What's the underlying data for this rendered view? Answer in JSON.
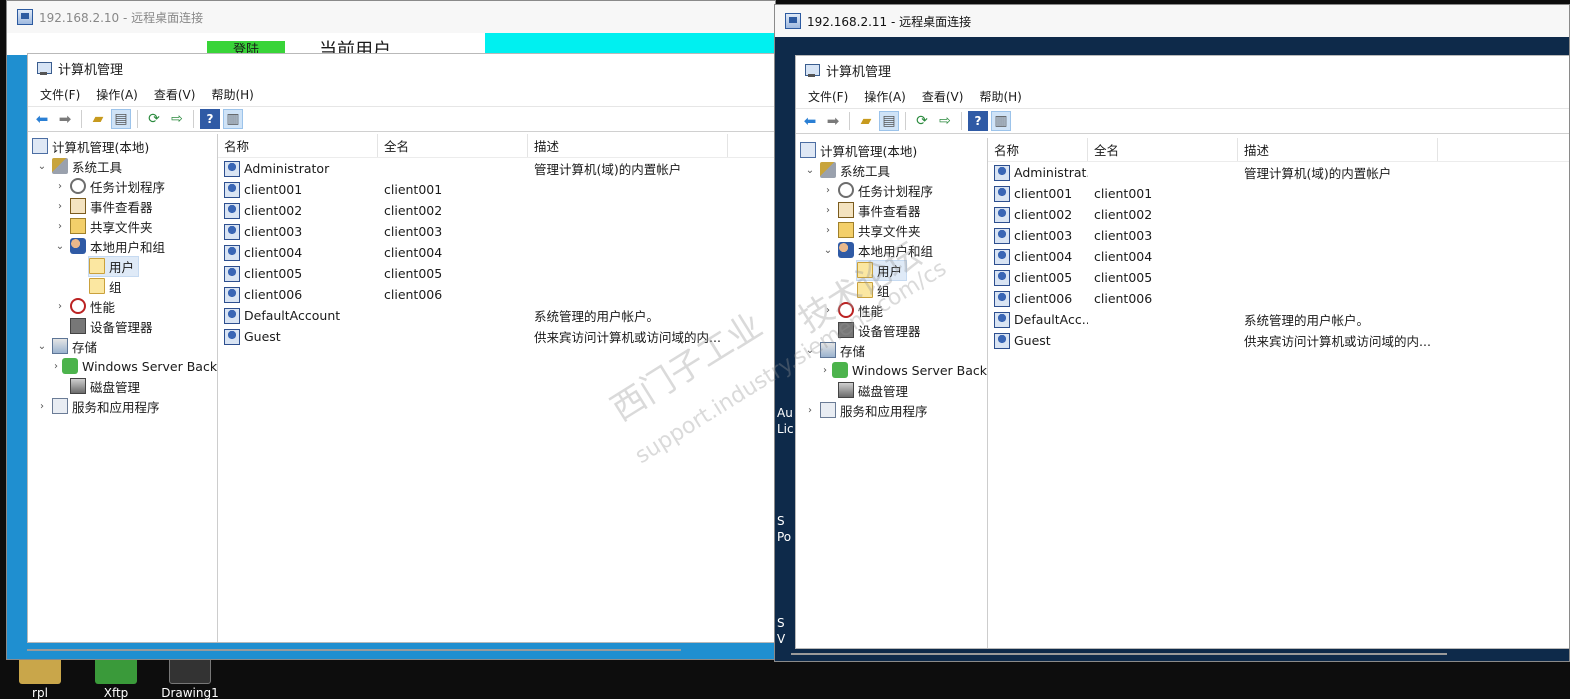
{
  "window_left": {
    "title": "192.168.2.10 - 远程桌面连接",
    "behind_text": [
      "登陆",
      "当前用户"
    ]
  },
  "window_right": {
    "title": "192.168.2.11 - 远程桌面连接",
    "behind_text": [
      "Au",
      "Lic",
      "S",
      "Po",
      "S",
      "V"
    ]
  },
  "mmc": {
    "title": "计算机管理",
    "menu": [
      "文件(F)",
      "操作(A)",
      "查看(V)",
      "帮助(H)"
    ]
  },
  "tree": {
    "root": "计算机管理(本地)",
    "system_tools": "系统工具",
    "task_scheduler": "任务计划程序",
    "event_viewer": "事件查看器",
    "shared_folders": "共享文件夹",
    "local_users_groups": "本地用户和组",
    "users": "用户",
    "groups": "组",
    "performance": "性能",
    "device_manager": "设备管理器",
    "storage": "存储",
    "windows_server_backup": "Windows Server Back",
    "disk_management": "磁盘管理",
    "services_apps": "服务和应用程序"
  },
  "list": {
    "columns": [
      "名称",
      "全名",
      "描述"
    ],
    "rows_left": [
      {
        "name": "Administrator",
        "full": "",
        "desc": "管理计算机(域)的内置帐户"
      },
      {
        "name": "client001",
        "full": "client001",
        "desc": ""
      },
      {
        "name": "client002",
        "full": "client002",
        "desc": ""
      },
      {
        "name": "client003",
        "full": "client003",
        "desc": ""
      },
      {
        "name": "client004",
        "full": "client004",
        "desc": ""
      },
      {
        "name": "client005",
        "full": "client005",
        "desc": ""
      },
      {
        "name": "client006",
        "full": "client006",
        "desc": ""
      },
      {
        "name": "DefaultAccount",
        "full": "",
        "desc": "系统管理的用户帐户。"
      },
      {
        "name": "Guest",
        "full": "",
        "desc": "供来宾访问计算机或访问域的内..."
      }
    ],
    "rows_right": [
      {
        "name": "Administrat...",
        "full": "",
        "desc": "管理计算机(域)的内置帐户"
      },
      {
        "name": "client001",
        "full": "client001",
        "desc": ""
      },
      {
        "name": "client002",
        "full": "client002",
        "desc": ""
      },
      {
        "name": "client003",
        "full": "client003",
        "desc": ""
      },
      {
        "name": "client004",
        "full": "client004",
        "desc": ""
      },
      {
        "name": "client005",
        "full": "client005",
        "desc": ""
      },
      {
        "name": "client006",
        "full": "client006",
        "desc": ""
      },
      {
        "name": "DefaultAcc...",
        "full": "",
        "desc": "系统管理的用户帐户。"
      },
      {
        "name": "Guest",
        "full": "",
        "desc": "供来宾访问计算机或访问域的内..."
      }
    ]
  },
  "desktop_icons": [
    "rpl",
    "Xftp",
    "Drawing1"
  ],
  "watermark": [
    "西门子工业",
    "技术论坛",
    "support.industry.siemens.com/cs"
  ],
  "colors": {
    "accent_blue": "#2a7fd4",
    "remote_left_bg": "#1f8fd0",
    "remote_left_top_cyan": "#00f0f0",
    "remote_right_bg": "#0e2a4a",
    "selection": "#dfeaf7"
  }
}
